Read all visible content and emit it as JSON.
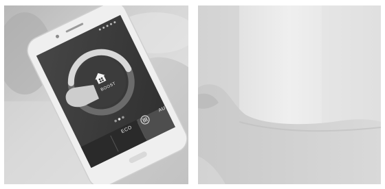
{
  "app": {
    "center_label": "BOOST",
    "buttons": {
      "left": "ECO",
      "right": "AUTO"
    },
    "icons": {
      "center": "home-icon",
      "bottom_center": "menu-icon"
    }
  },
  "colors": {
    "background": "#ffffff",
    "phone_screen": "#3a3a3a",
    "phone_body": "#efefef",
    "ring": "#8c8c8c",
    "ring_light": "#d8d8d8"
  }
}
